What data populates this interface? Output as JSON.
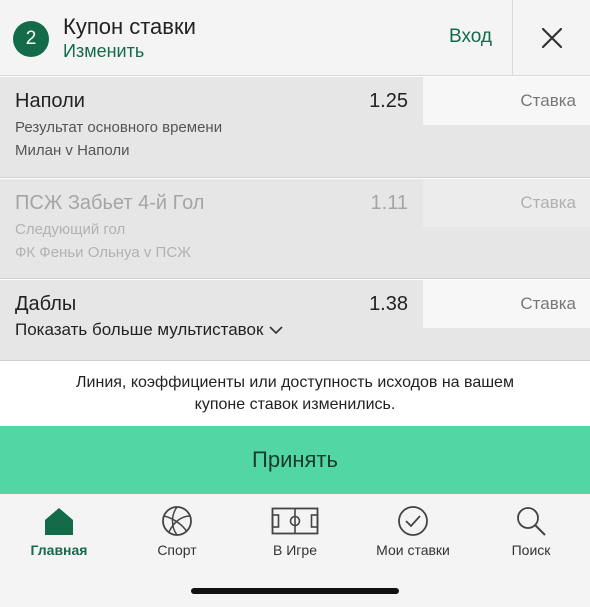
{
  "header": {
    "count": "2",
    "title": "Купон ставки",
    "edit_label": "Изменить",
    "login_label": "Вход"
  },
  "bets": [
    {
      "name": "Наполи",
      "odds": "1.25",
      "market": "Результат основного времени",
      "match": "Милан v Наполи",
      "stake_placeholder": "Ставка"
    },
    {
      "name": "ПСЖ Забьет 4-й Гол",
      "odds": "1.11",
      "market": "Следующий гол",
      "match": "ФК Феньи Ольнуа v ПСЖ",
      "stake_placeholder": "Ставка"
    }
  ],
  "doubles": {
    "name": "Даблы",
    "odds": "1.38",
    "stake_placeholder": "Ставка",
    "more_label": "Показать больше мультиставок"
  },
  "notice": {
    "line1": "Линия, коэффициенты или доступность исходов на вашем",
    "line2": "купоне ставок изменились."
  },
  "accept_label": "Принять",
  "nav": {
    "items": [
      {
        "label": "Главная",
        "icon": "home-icon"
      },
      {
        "label": "Спорт",
        "icon": "ball-icon"
      },
      {
        "label": "В Игре",
        "icon": "field-icon"
      },
      {
        "label": "Мои ставки",
        "icon": "check-circle-icon"
      },
      {
        "label": "Поиск",
        "icon": "search-icon"
      }
    ],
    "active": "Главная"
  },
  "colors": {
    "brand": "#136b49",
    "accept": "#52d6a4",
    "surface": "#e6e6e6"
  }
}
